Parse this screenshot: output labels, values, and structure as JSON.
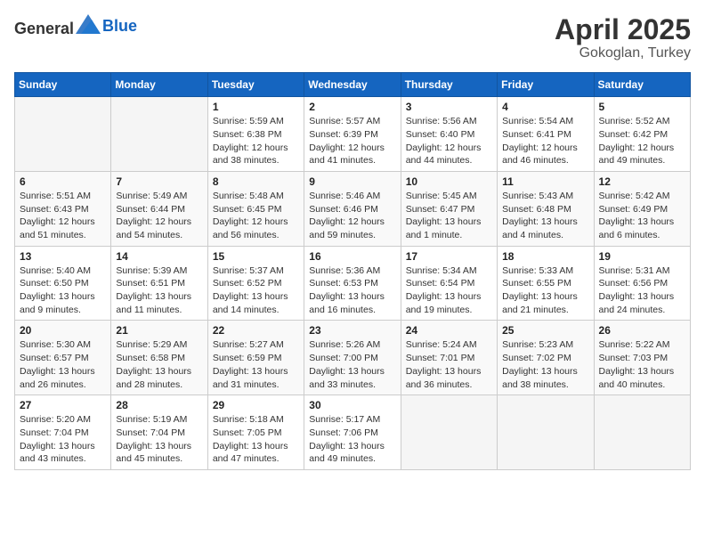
{
  "header": {
    "logo_general": "General",
    "logo_blue": "Blue",
    "month": "April 2025",
    "location": "Gokoglan, Turkey"
  },
  "weekdays": [
    "Sunday",
    "Monday",
    "Tuesday",
    "Wednesday",
    "Thursday",
    "Friday",
    "Saturday"
  ],
  "weeks": [
    [
      {
        "day": "",
        "info": ""
      },
      {
        "day": "",
        "info": ""
      },
      {
        "day": "1",
        "info": "Sunrise: 5:59 AM\nSunset: 6:38 PM\nDaylight: 12 hours and 38 minutes."
      },
      {
        "day": "2",
        "info": "Sunrise: 5:57 AM\nSunset: 6:39 PM\nDaylight: 12 hours and 41 minutes."
      },
      {
        "day": "3",
        "info": "Sunrise: 5:56 AM\nSunset: 6:40 PM\nDaylight: 12 hours and 44 minutes."
      },
      {
        "day": "4",
        "info": "Sunrise: 5:54 AM\nSunset: 6:41 PM\nDaylight: 12 hours and 46 minutes."
      },
      {
        "day": "5",
        "info": "Sunrise: 5:52 AM\nSunset: 6:42 PM\nDaylight: 12 hours and 49 minutes."
      }
    ],
    [
      {
        "day": "6",
        "info": "Sunrise: 5:51 AM\nSunset: 6:43 PM\nDaylight: 12 hours and 51 minutes."
      },
      {
        "day": "7",
        "info": "Sunrise: 5:49 AM\nSunset: 6:44 PM\nDaylight: 12 hours and 54 minutes."
      },
      {
        "day": "8",
        "info": "Sunrise: 5:48 AM\nSunset: 6:45 PM\nDaylight: 12 hours and 56 minutes."
      },
      {
        "day": "9",
        "info": "Sunrise: 5:46 AM\nSunset: 6:46 PM\nDaylight: 12 hours and 59 minutes."
      },
      {
        "day": "10",
        "info": "Sunrise: 5:45 AM\nSunset: 6:47 PM\nDaylight: 13 hours and 1 minute."
      },
      {
        "day": "11",
        "info": "Sunrise: 5:43 AM\nSunset: 6:48 PM\nDaylight: 13 hours and 4 minutes."
      },
      {
        "day": "12",
        "info": "Sunrise: 5:42 AM\nSunset: 6:49 PM\nDaylight: 13 hours and 6 minutes."
      }
    ],
    [
      {
        "day": "13",
        "info": "Sunrise: 5:40 AM\nSunset: 6:50 PM\nDaylight: 13 hours and 9 minutes."
      },
      {
        "day": "14",
        "info": "Sunrise: 5:39 AM\nSunset: 6:51 PM\nDaylight: 13 hours and 11 minutes."
      },
      {
        "day": "15",
        "info": "Sunrise: 5:37 AM\nSunset: 6:52 PM\nDaylight: 13 hours and 14 minutes."
      },
      {
        "day": "16",
        "info": "Sunrise: 5:36 AM\nSunset: 6:53 PM\nDaylight: 13 hours and 16 minutes."
      },
      {
        "day": "17",
        "info": "Sunrise: 5:34 AM\nSunset: 6:54 PM\nDaylight: 13 hours and 19 minutes."
      },
      {
        "day": "18",
        "info": "Sunrise: 5:33 AM\nSunset: 6:55 PM\nDaylight: 13 hours and 21 minutes."
      },
      {
        "day": "19",
        "info": "Sunrise: 5:31 AM\nSunset: 6:56 PM\nDaylight: 13 hours and 24 minutes."
      }
    ],
    [
      {
        "day": "20",
        "info": "Sunrise: 5:30 AM\nSunset: 6:57 PM\nDaylight: 13 hours and 26 minutes."
      },
      {
        "day": "21",
        "info": "Sunrise: 5:29 AM\nSunset: 6:58 PM\nDaylight: 13 hours and 28 minutes."
      },
      {
        "day": "22",
        "info": "Sunrise: 5:27 AM\nSunset: 6:59 PM\nDaylight: 13 hours and 31 minutes."
      },
      {
        "day": "23",
        "info": "Sunrise: 5:26 AM\nSunset: 7:00 PM\nDaylight: 13 hours and 33 minutes."
      },
      {
        "day": "24",
        "info": "Sunrise: 5:24 AM\nSunset: 7:01 PM\nDaylight: 13 hours and 36 minutes."
      },
      {
        "day": "25",
        "info": "Sunrise: 5:23 AM\nSunset: 7:02 PM\nDaylight: 13 hours and 38 minutes."
      },
      {
        "day": "26",
        "info": "Sunrise: 5:22 AM\nSunset: 7:03 PM\nDaylight: 13 hours and 40 minutes."
      }
    ],
    [
      {
        "day": "27",
        "info": "Sunrise: 5:20 AM\nSunset: 7:04 PM\nDaylight: 13 hours and 43 minutes."
      },
      {
        "day": "28",
        "info": "Sunrise: 5:19 AM\nSunset: 7:04 PM\nDaylight: 13 hours and 45 minutes."
      },
      {
        "day": "29",
        "info": "Sunrise: 5:18 AM\nSunset: 7:05 PM\nDaylight: 13 hours and 47 minutes."
      },
      {
        "day": "30",
        "info": "Sunrise: 5:17 AM\nSunset: 7:06 PM\nDaylight: 13 hours and 49 minutes."
      },
      {
        "day": "",
        "info": ""
      },
      {
        "day": "",
        "info": ""
      },
      {
        "day": "",
        "info": ""
      }
    ]
  ]
}
